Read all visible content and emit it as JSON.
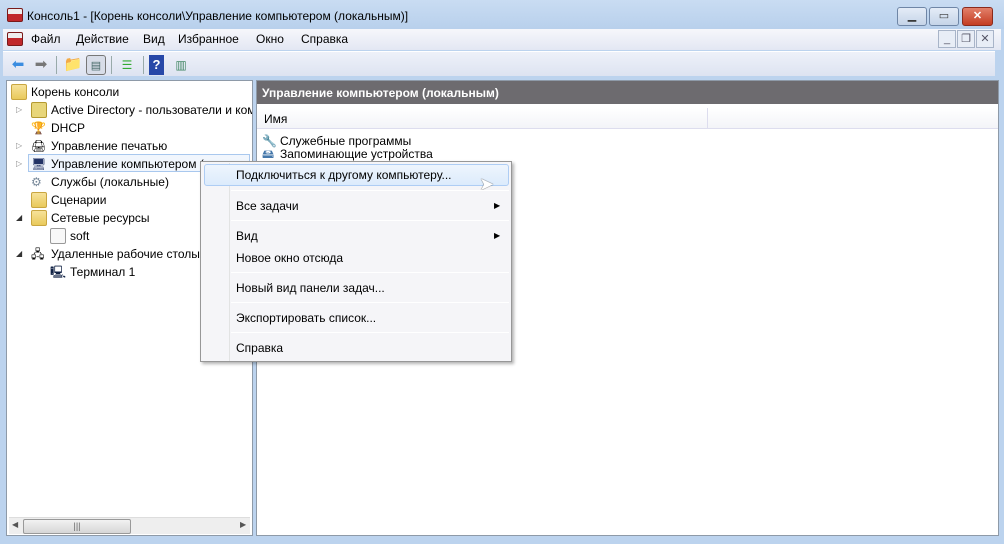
{
  "window": {
    "title": "Консоль1 - [Корень консоли\\Управление компьютером (локальным)]"
  },
  "menu": [
    "Файл",
    "Действие",
    "Вид",
    "Избранное",
    "Окно",
    "Справка"
  ],
  "toolbar": [
    "back-icon",
    "forward-icon",
    "up-folder-icon",
    "show-hide-tree-icon",
    "export-list-icon",
    "help-icon",
    "show-action-pane-icon"
  ],
  "tree": [
    {
      "label": "Корень консоли"
    },
    {
      "label": "Active Directory - пользователи и компьютеры"
    },
    {
      "label": "DHCP"
    },
    {
      "label": "Управление печатью"
    },
    {
      "label": "Управление компьютером (локальным)"
    },
    {
      "label": "Службы (локальные)"
    },
    {
      "label": "Сценарии"
    },
    {
      "label": "Сетевые ресурсы"
    },
    {
      "label": "soft"
    },
    {
      "label": "Удаленные рабочие столы"
    },
    {
      "label": "Терминал 1"
    }
  ],
  "right": {
    "header": "Управление компьютером (локальным)",
    "column": "Имя",
    "items": [
      "Служебные программы",
      "Запоминающие устройства"
    ]
  },
  "context_menu": [
    "Подключиться к другому компьютеру...",
    "Все задачи",
    "Вид",
    "Новое окно отсюда",
    "Новый вид панели задач...",
    "Экспортировать список...",
    "Справка"
  ]
}
